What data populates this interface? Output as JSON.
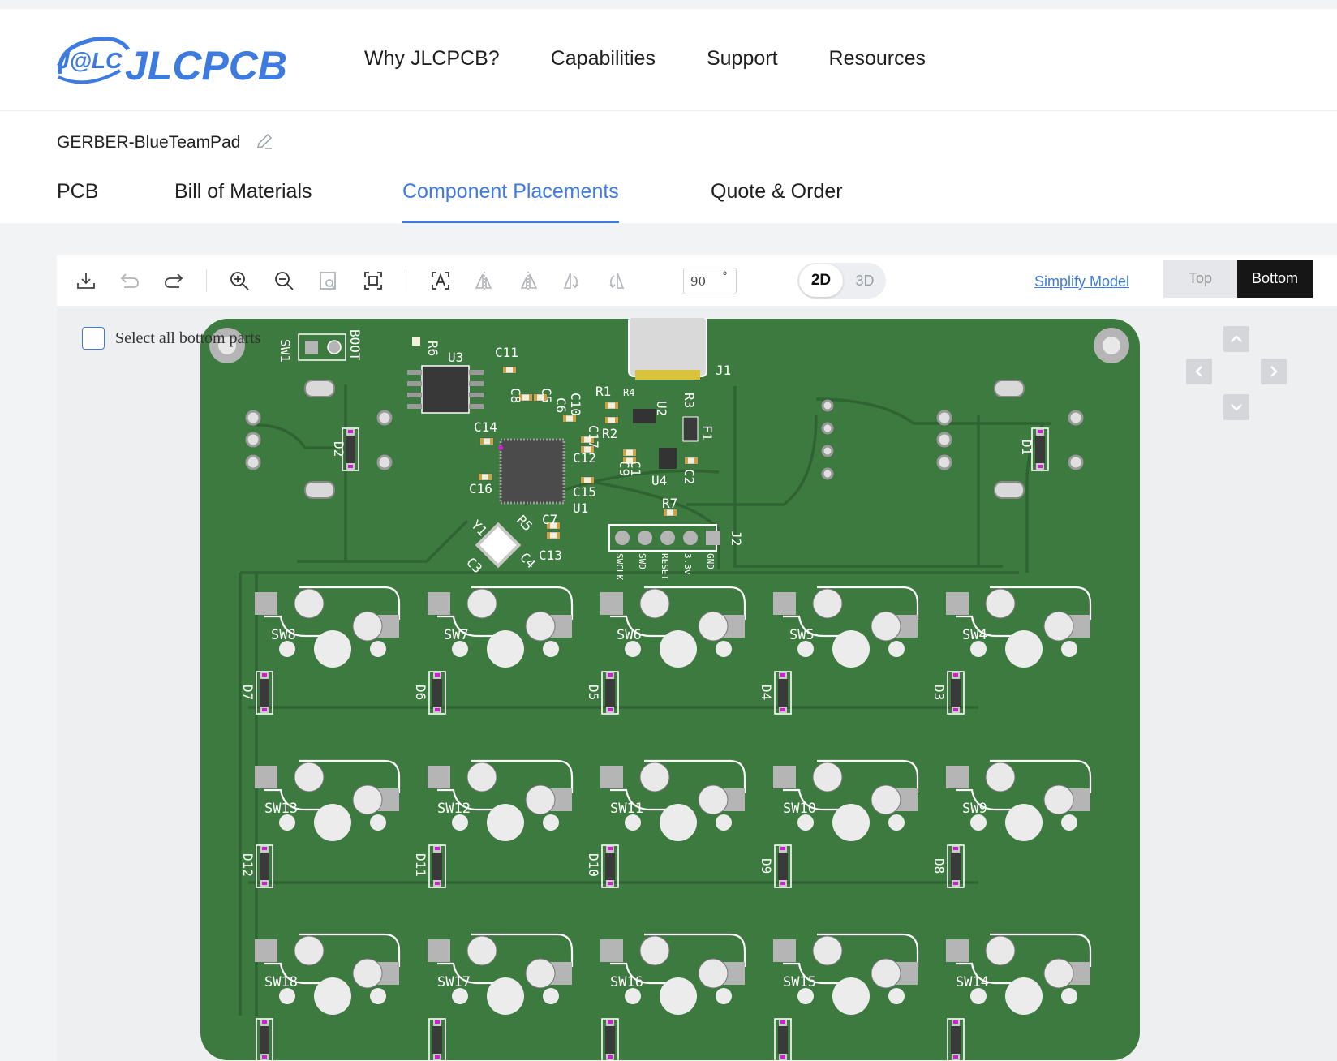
{
  "brand": {
    "logo_badge": "J@LC",
    "logo_text": "JLCPCB",
    "color": "#3d7be0"
  },
  "nav": [
    "Why JLCPCB?",
    "Capabilities",
    "Support",
    "Resources"
  ],
  "project": {
    "name": "GERBER-BlueTeamPad"
  },
  "tabs": [
    "PCB",
    "Bill of Materials",
    "Component Placements",
    "Quote & Order"
  ],
  "active_tab": "Component Placements",
  "toolbar": {
    "icons": [
      "download-icon",
      "undo-icon",
      "redo-icon",
      "zoom-in-icon",
      "zoom-out-icon",
      "zoom-area-icon",
      "fit-screen-icon",
      "auto-text-icon",
      "flip-horizontal-icon",
      "flip-vertical-icon",
      "rotate-ccw-icon",
      "rotate-cw-icon"
    ],
    "angle_value": "90",
    "angle_unit": "°",
    "view_2d": "2D",
    "view_3d": "3D",
    "simplify_model": "Simplify Model",
    "side_top": "Top",
    "side_bottom": "Bottom"
  },
  "select_all_label": "Select all bottom parts",
  "board": {
    "color": "#3d7a3f",
    "top_labels": [
      "SW1",
      "BOOT",
      "R6",
      "U3",
      "C11",
      "J1",
      "C8",
      "C5",
      "C6",
      "C10",
      "R1",
      "R4",
      "U2",
      "R3",
      "C14",
      "C17",
      "R2",
      "F1",
      "D2",
      "C12",
      "C9",
      "C1",
      "U4",
      "C2",
      "D1",
      "C16",
      "C15",
      "U1",
      "R7",
      "C7",
      "Y1",
      "R5",
      "J2",
      "C13",
      "C3",
      "C4"
    ],
    "j2_pins": [
      "SWCLK",
      "SWD",
      "RESET",
      "3.3v",
      "GND"
    ],
    "switches": [
      [
        "SW8",
        "SW7",
        "SW6",
        "SW5",
        "SW4"
      ],
      [
        "SW13",
        "SW12",
        "SW11",
        "SW10",
        "SW9"
      ],
      [
        "SW18",
        "SW17",
        "SW16",
        "SW15",
        "SW14"
      ]
    ],
    "diodes": [
      [
        "D7",
        "D6",
        "D5",
        "D4",
        "D3"
      ],
      [
        "D12",
        "D11",
        "D10",
        "D9",
        "D8"
      ]
    ]
  },
  "pan_controls": [
    "pan-up-icon",
    "pan-left-icon",
    "pan-right-icon",
    "pan-down-icon"
  ]
}
